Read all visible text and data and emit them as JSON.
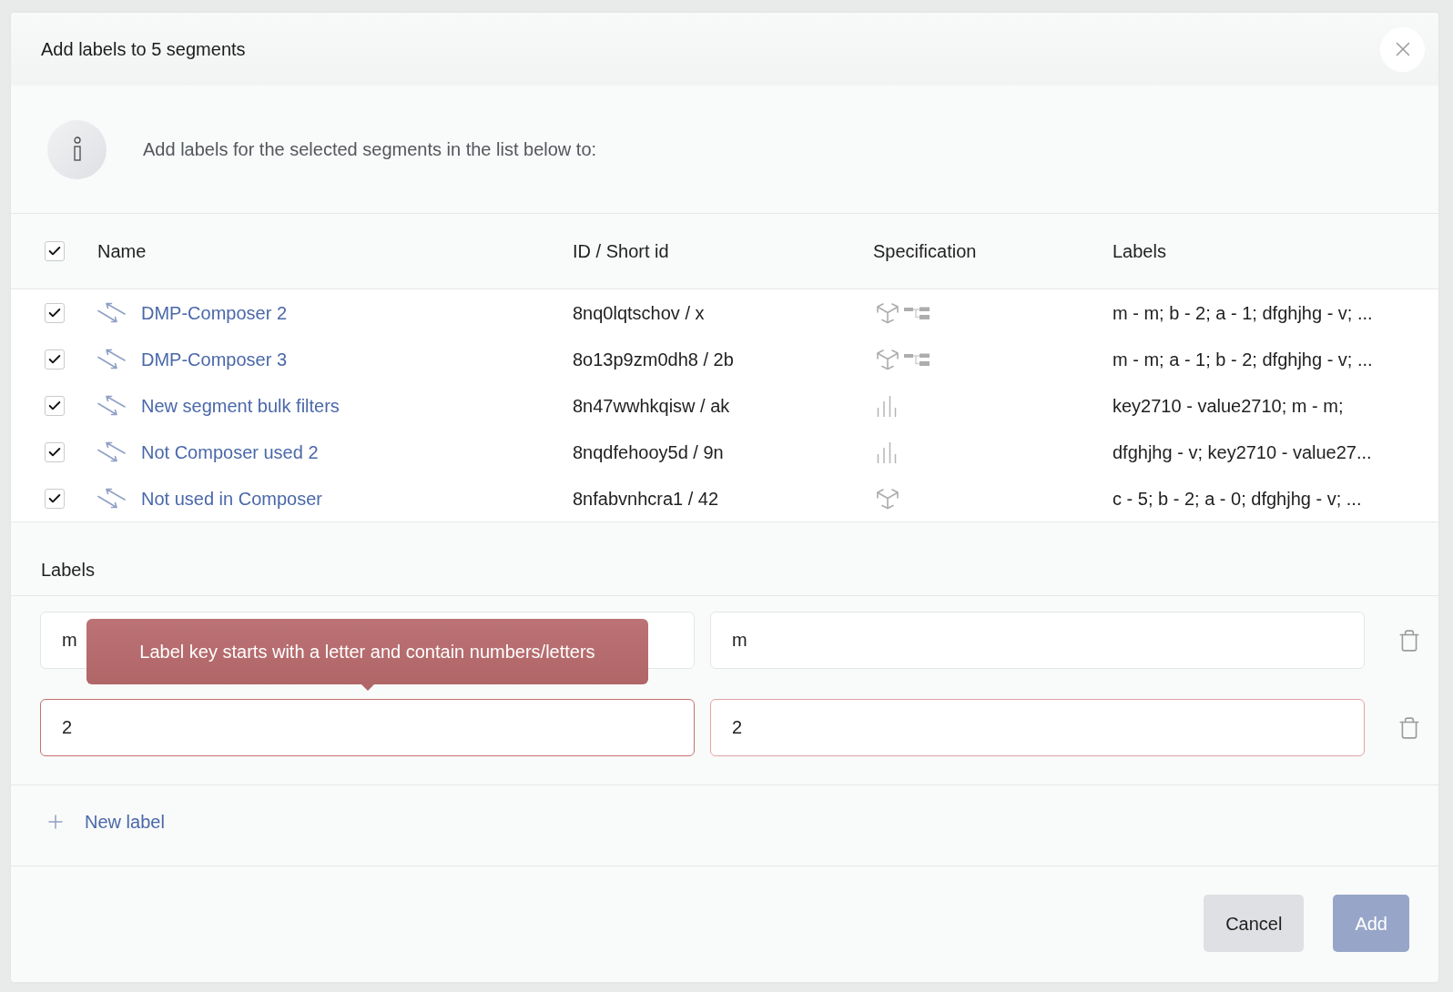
{
  "dialog": {
    "title": "Add labels to 5 segments",
    "info_text": "Add labels for the selected segments in the list below to:"
  },
  "table": {
    "select_all": {
      "checked": true
    },
    "columns": [
      "Name",
      "ID / Short id",
      "Specification",
      "Labels"
    ],
    "rows": [
      {
        "checked": true,
        "name": "DMP-Composer 2",
        "id": "8nq0lqtschov / x",
        "specification": [
          {
            "kind": "cube"
          },
          {
            "kind": "tree"
          }
        ],
        "labels": "m - m; b - 2; a - 1; dfghjhg - v; ..."
      },
      {
        "checked": true,
        "name": "DMP-Composer 3",
        "id": "8o13p9zm0dh8 / 2b",
        "specification": [
          {
            "kind": "cube"
          },
          {
            "kind": "tree"
          }
        ],
        "labels": "m - m; a - 1; b - 2; dfghjhg - v; ..."
      },
      {
        "checked": true,
        "name": "New segment bulk filters",
        "id": "8n47wwhkqisw / ak",
        "specification": [
          {
            "kind": "bars"
          }
        ],
        "labels": "key2710 - value2710; m - m;"
      },
      {
        "checked": true,
        "name": "Not Composer used 2",
        "id": "8nqdfehooy5d / 9n",
        "specification": [
          {
            "kind": "bars"
          }
        ],
        "labels": "dfghjhg - v; key2710 - value27..."
      },
      {
        "checked": true,
        "name": "Not used in Composer",
        "id": "8nfabvnhcra1 / 42",
        "specification": [
          {
            "kind": "cube"
          }
        ],
        "labels": "c - 5; b - 2; a - 0; dfghjhg - v; ..."
      }
    ]
  },
  "labels_form": {
    "title": "Labels",
    "rows": [
      {
        "key": "m",
        "value": "m",
        "invalid": false
      },
      {
        "key": "2",
        "value": "2",
        "invalid": true,
        "error": "Label key starts with a letter and contain numbers/letters"
      }
    ],
    "add_button": "New label"
  },
  "footer": {
    "buttons": [
      {
        "label": "Cancel",
        "kind": "secondary",
        "disabled": false
      },
      {
        "label": "Add",
        "kind": "primary",
        "disabled": true
      }
    ]
  }
}
